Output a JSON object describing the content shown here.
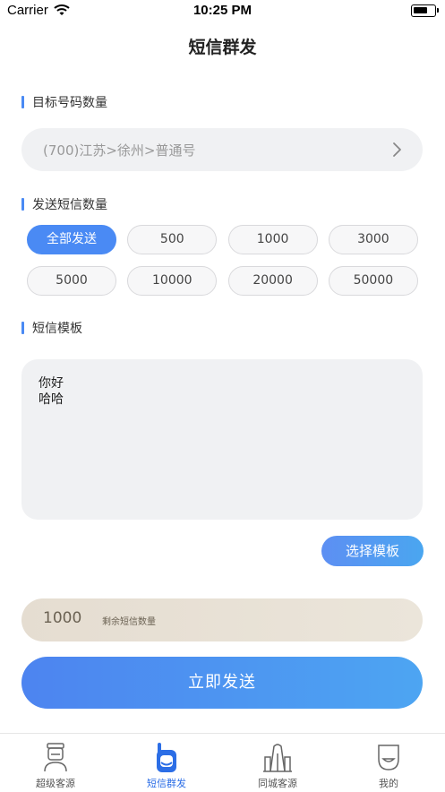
{
  "status_bar": {
    "carrier": "Carrier",
    "time": "10:25 PM",
    "battery_level": 0.7
  },
  "nav": {
    "title": "短信群发"
  },
  "target": {
    "label": "目标号码数量",
    "value": "(700)江苏>徐州>普通号"
  },
  "quantity": {
    "label": "发送短信数量",
    "options": [
      "全部发送",
      "500",
      "1000",
      "3000",
      "5000",
      "10000",
      "20000",
      "50000"
    ],
    "selected": "全部发送"
  },
  "template": {
    "label": "短信模板",
    "lines": [
      "你好",
      "哈哈"
    ],
    "choose_label": "选择模板"
  },
  "remaining": {
    "value": "1000",
    "label": "剩余短信数量"
  },
  "send": {
    "label": "立即发送"
  },
  "tabbar": {
    "items": [
      {
        "label": "超级客源",
        "icon": "person-icon"
      },
      {
        "label": "短信群发",
        "icon": "phone-icon"
      },
      {
        "label": "同城客源",
        "icon": "building-icon"
      },
      {
        "label": "我的",
        "icon": "face-icon"
      }
    ],
    "active": "短信群发"
  },
  "colors": {
    "accent": "#4a8af4",
    "tab_active": "#2c6ee6",
    "remain_bg": "#e5ddd1",
    "field_bg": "#f0f1f3"
  }
}
